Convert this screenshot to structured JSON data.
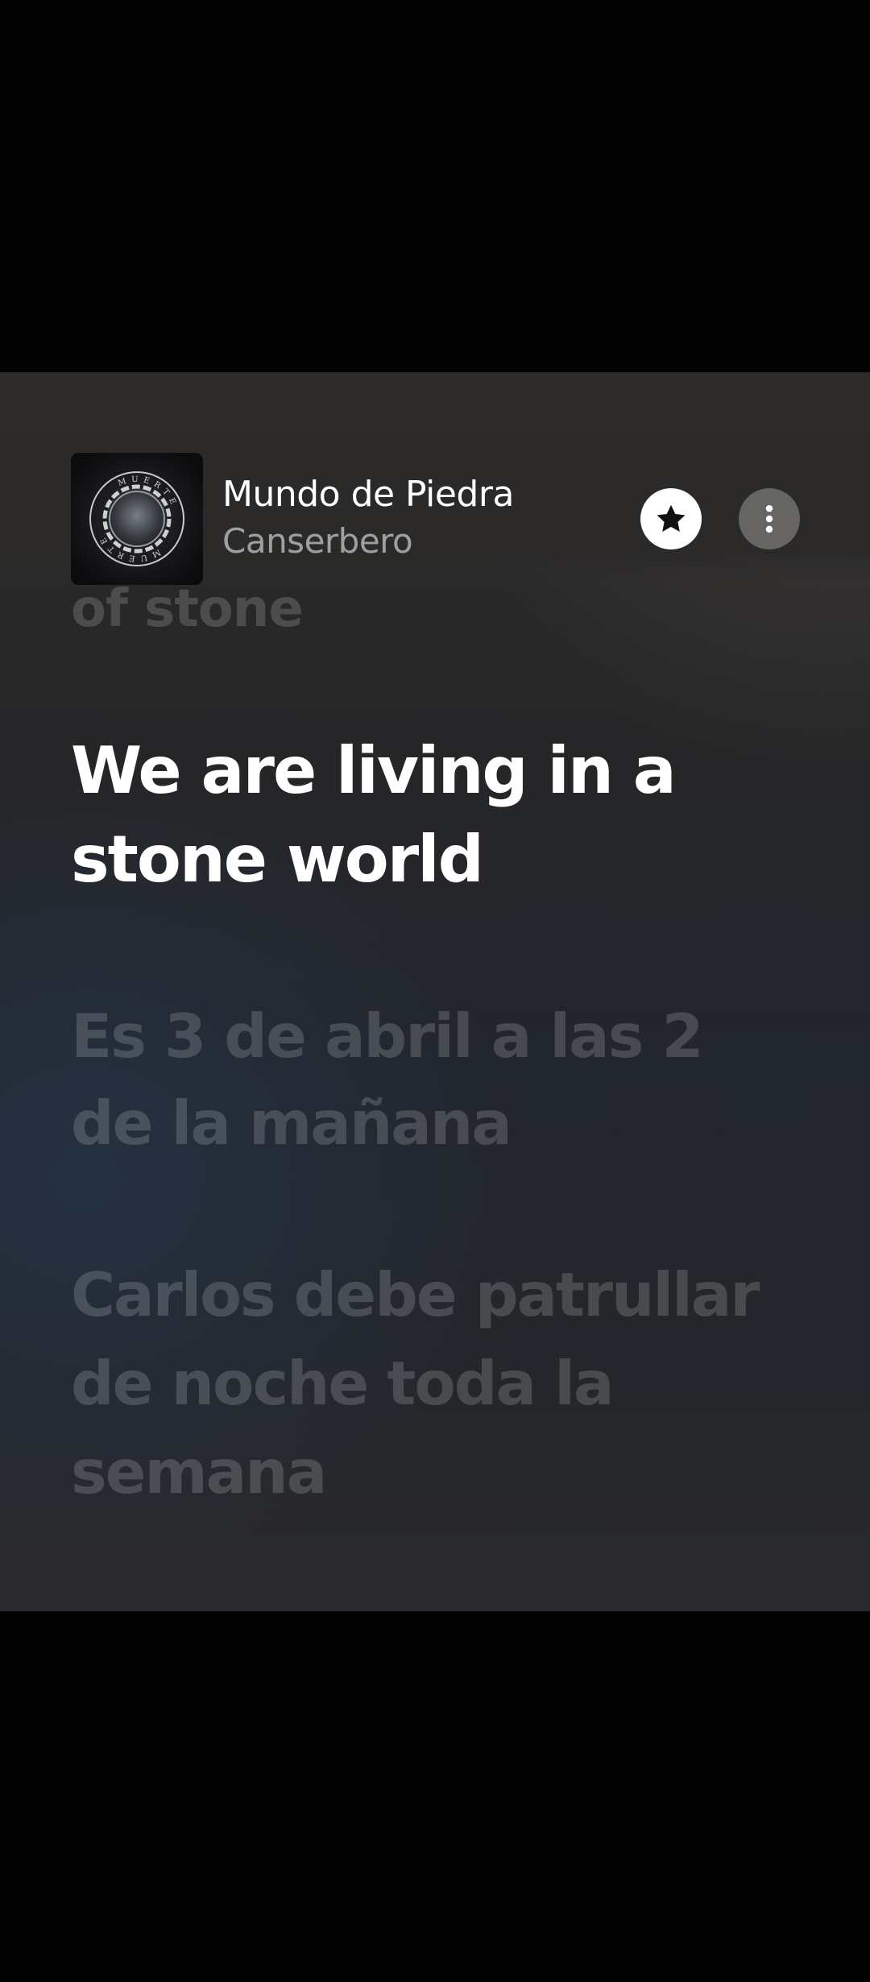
{
  "now_playing": {
    "title": "Mundo de Piedra",
    "artist": "Canserbero",
    "artwork_text": "MUERTE"
  },
  "actions": {
    "favorite_icon": "star-icon",
    "more_icon": "more-vertical-icon"
  },
  "lyrics": {
    "previous": "of stone",
    "current": "We are living in a stone world",
    "upcoming": [
      "Es 3 de abril a las 2 de la mañana",
      "Carlos debe patrullar de noche toda la semana"
    ]
  },
  "colors": {
    "background": "#000000",
    "player_background": "#26272b",
    "current_lyric": "#ffffff",
    "inactive_lyric": "#4a4c51",
    "artist_text": "#9a9a9c"
  }
}
